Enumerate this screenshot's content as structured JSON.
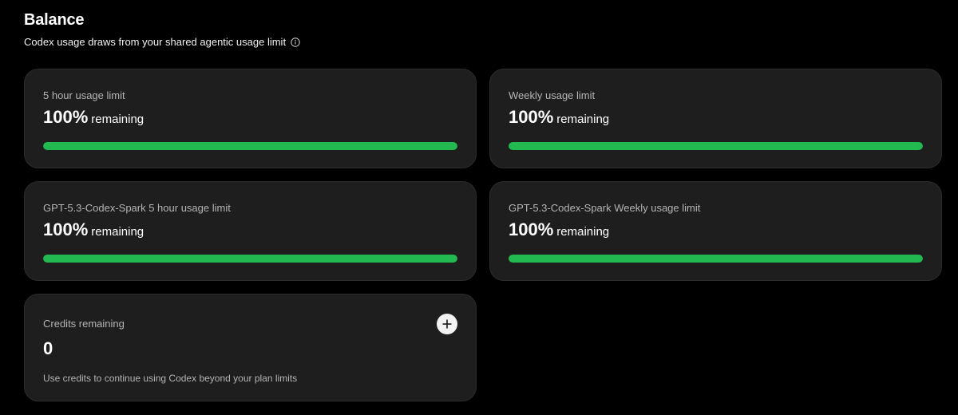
{
  "header": {
    "title": "Balance",
    "subtitle": "Codex usage draws from your shared agentic usage limit",
    "info_icon": "info-circle-icon"
  },
  "colors": {
    "background": "#000000",
    "card": "#1e1e1e",
    "progress_fill": "#22b950",
    "progress_track": "#3a3a3a"
  },
  "limits": [
    {
      "label": "5 hour usage limit",
      "percent": "100%",
      "suffix": "remaining",
      "fill": 1.0
    },
    {
      "label": "Weekly usage limit",
      "percent": "100%",
      "suffix": "remaining",
      "fill": 1.0
    },
    {
      "label": "GPT-5.3-Codex-Spark 5 hour usage limit",
      "percent": "100%",
      "suffix": "remaining",
      "fill": 1.0
    },
    {
      "label": "GPT-5.3-Codex-Spark Weekly usage limit",
      "percent": "100%",
      "suffix": "remaining",
      "fill": 1.0
    }
  ],
  "credits": {
    "label": "Credits remaining",
    "value": "0",
    "note": "Use credits to continue using Codex beyond your plan limits",
    "add_icon": "plus-icon"
  }
}
